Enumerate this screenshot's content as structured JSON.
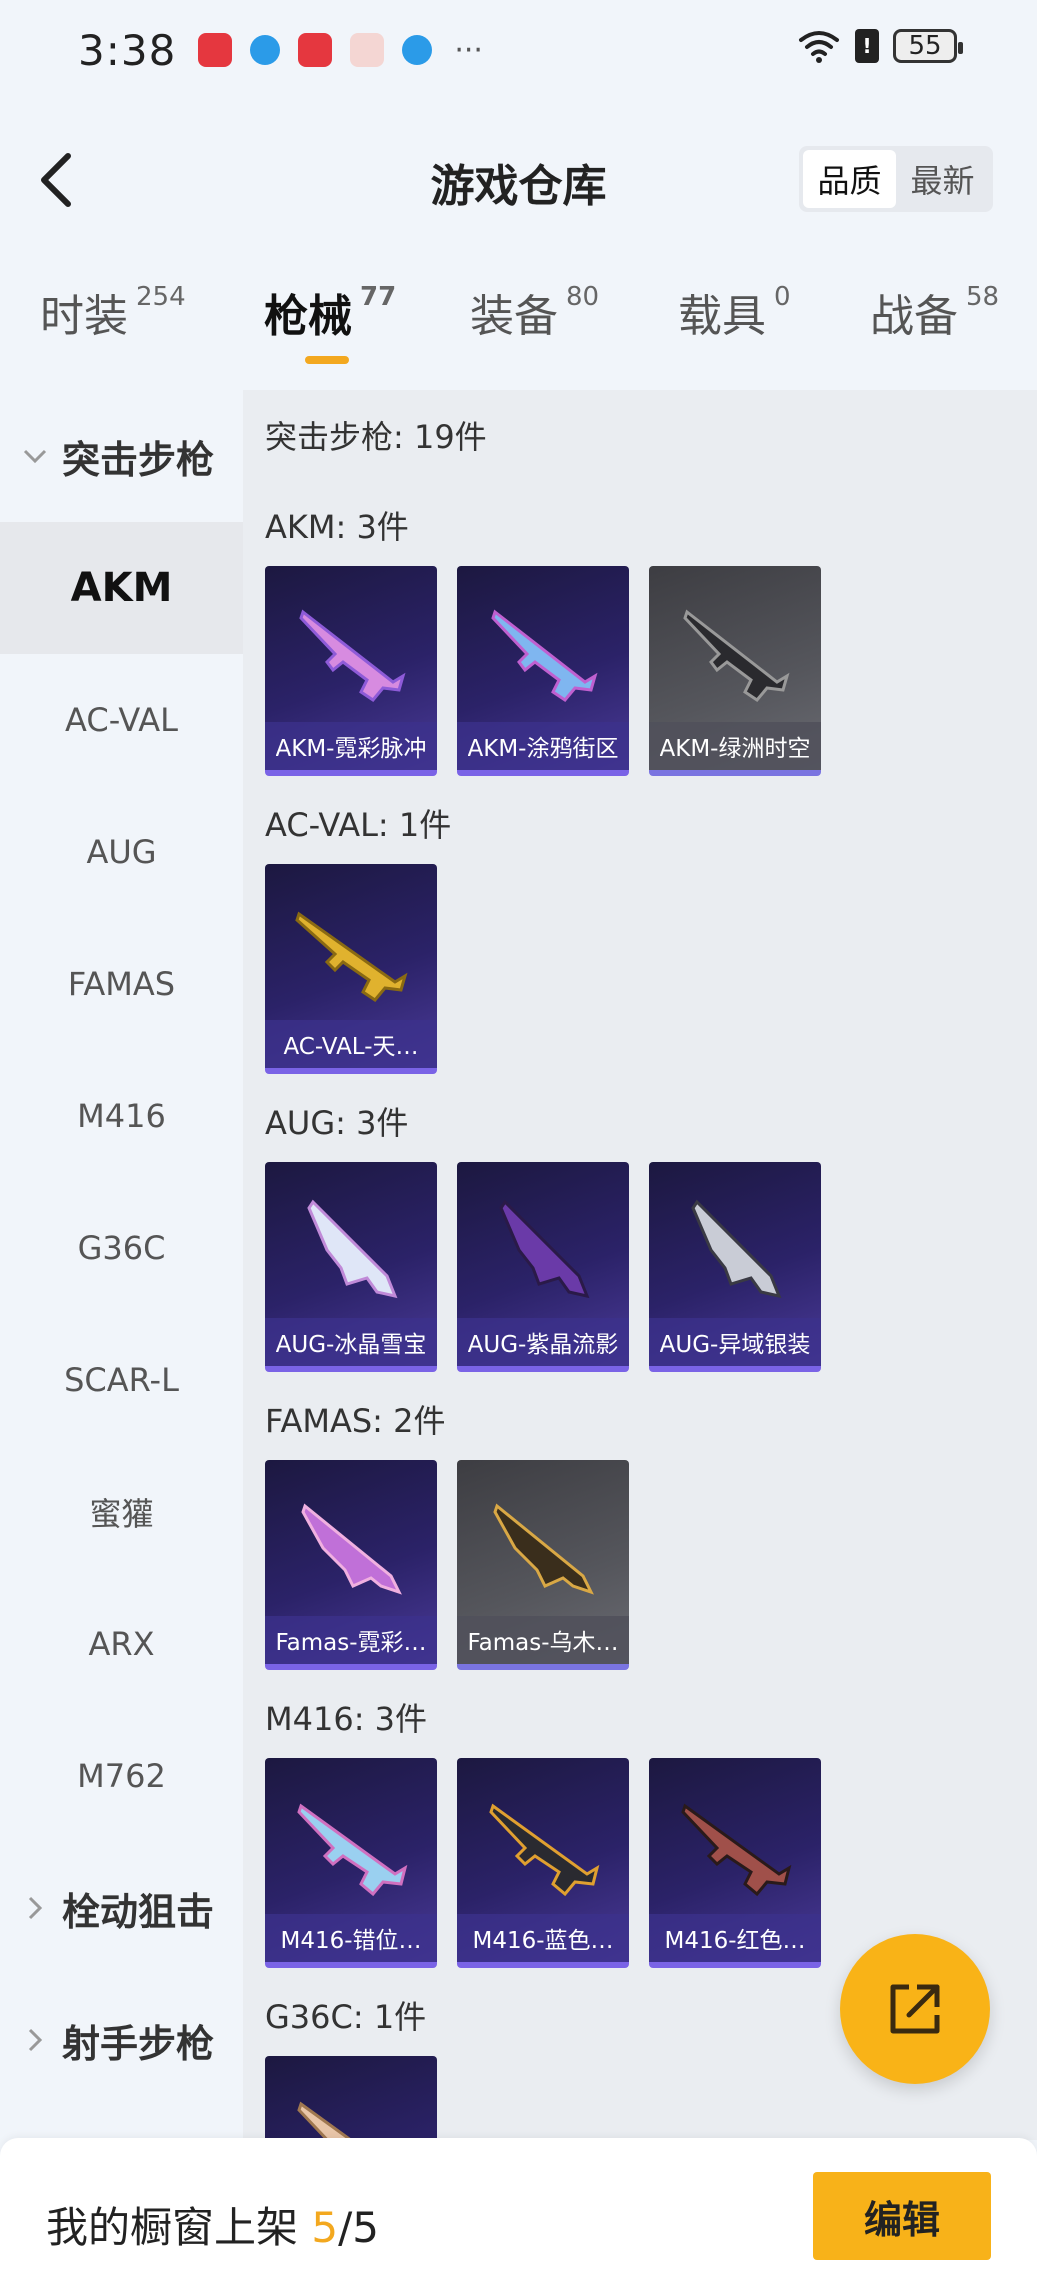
{
  "status_bar": {
    "time": "3:38",
    "battery": "55",
    "sim_mark": "!",
    "more": "···"
  },
  "header": {
    "title": "游戏仓库",
    "sort_options": [
      "品质",
      "最新"
    ]
  },
  "tabs": [
    {
      "label": "时装",
      "count": "254"
    },
    {
      "label": "枪械",
      "count": "77"
    },
    {
      "label": "装备",
      "count": "80"
    },
    {
      "label": "载具",
      "count": "0"
    },
    {
      "label": "战备",
      "count": "58"
    }
  ],
  "sidebar": {
    "group_open": "突击步枪",
    "items": [
      "AKM",
      "AC-VAL",
      "AUG",
      "FAMAS",
      "M416",
      "G36C",
      "SCAR-L",
      "蜜獾",
      "ARX",
      "M762"
    ],
    "groups_closed": [
      "栓动狙击",
      "射手步枪"
    ]
  },
  "content": {
    "summary": "突击步枪: 19件",
    "sections": [
      {
        "title": "AKM: 3件",
        "cards": [
          "AKM-霓彩脉冲",
          "AKM-涂鸦街区",
          "AKM-绿洲时空"
        ]
      },
      {
        "title": "AC-VAL: 1件",
        "cards": [
          "AC-VAL-天…"
        ]
      },
      {
        "title": "AUG: 3件",
        "cards": [
          "AUG-冰晶雪宝",
          "AUG-紫晶流影",
          "AUG-异域银装"
        ]
      },
      {
        "title": "FAMAS: 2件",
        "cards": [
          "Famas-霓彩…",
          "Famas-乌木…"
        ]
      },
      {
        "title": "M416: 3件",
        "cards": [
          "M416-错位…",
          "M416-蓝色…",
          "M416-红色…"
        ]
      },
      {
        "title": "G36C: 1件",
        "cards": [
          ""
        ]
      }
    ]
  },
  "bottom": {
    "label": "我的橱窗上架 ",
    "current": "5",
    "total": "/5",
    "edit": "编辑"
  }
}
